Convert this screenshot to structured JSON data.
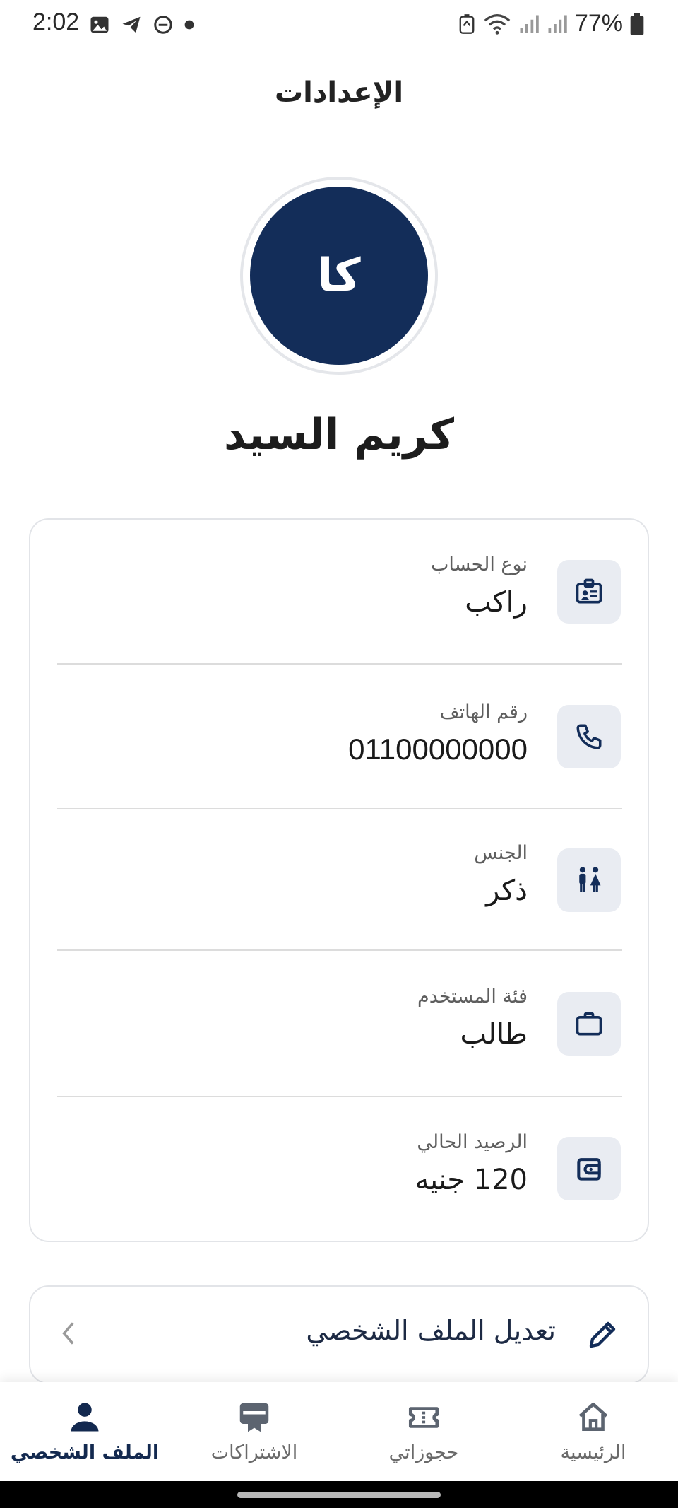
{
  "status_bar": {
    "time": "2:02",
    "left_icons": [
      "image-icon",
      "telegram-icon",
      "dnd-icon",
      "dot-icon"
    ],
    "right_icons": [
      "battery-saver-icon",
      "wifi-icon",
      "signal-icon",
      "signal-icon",
      "battery-icon"
    ],
    "battery": "77%"
  },
  "header": {
    "title": "الإعدادات"
  },
  "profile": {
    "initials": "كا",
    "name": "كريم السيد"
  },
  "info": {
    "rows": [
      {
        "label": "نوع الحساب",
        "value": "راكب",
        "icon": "id-badge-icon"
      },
      {
        "label": "رقم الهاتف",
        "value": "01100000000",
        "icon": "phone-icon"
      },
      {
        "label": "الجنس",
        "value": "ذكر",
        "icon": "people-icon"
      },
      {
        "label": "فئة المستخدم",
        "value": "طالب",
        "icon": "briefcase-icon"
      },
      {
        "label": "الرصيد الحالي",
        "value": "120 جنيه",
        "icon": "wallet-icon"
      }
    ]
  },
  "edit_profile": {
    "label": "تعديل الملف الشخصي",
    "icon": "pencil-icon"
  },
  "nav": {
    "items": [
      {
        "label": "الرئيسية",
        "icon": "home-icon",
        "active": false
      },
      {
        "label": "حجوزاتي",
        "icon": "ticket-icon",
        "active": false
      },
      {
        "label": "الاشتراكات",
        "icon": "subscription-icon",
        "active": false
      },
      {
        "label": "الملف الشخصي",
        "icon": "person-icon",
        "active": true
      }
    ]
  },
  "colors": {
    "primary": "#132d59",
    "icon_bg": "#e9ecf2",
    "divider": "#dcdcdc",
    "border": "#e2e4e8"
  }
}
